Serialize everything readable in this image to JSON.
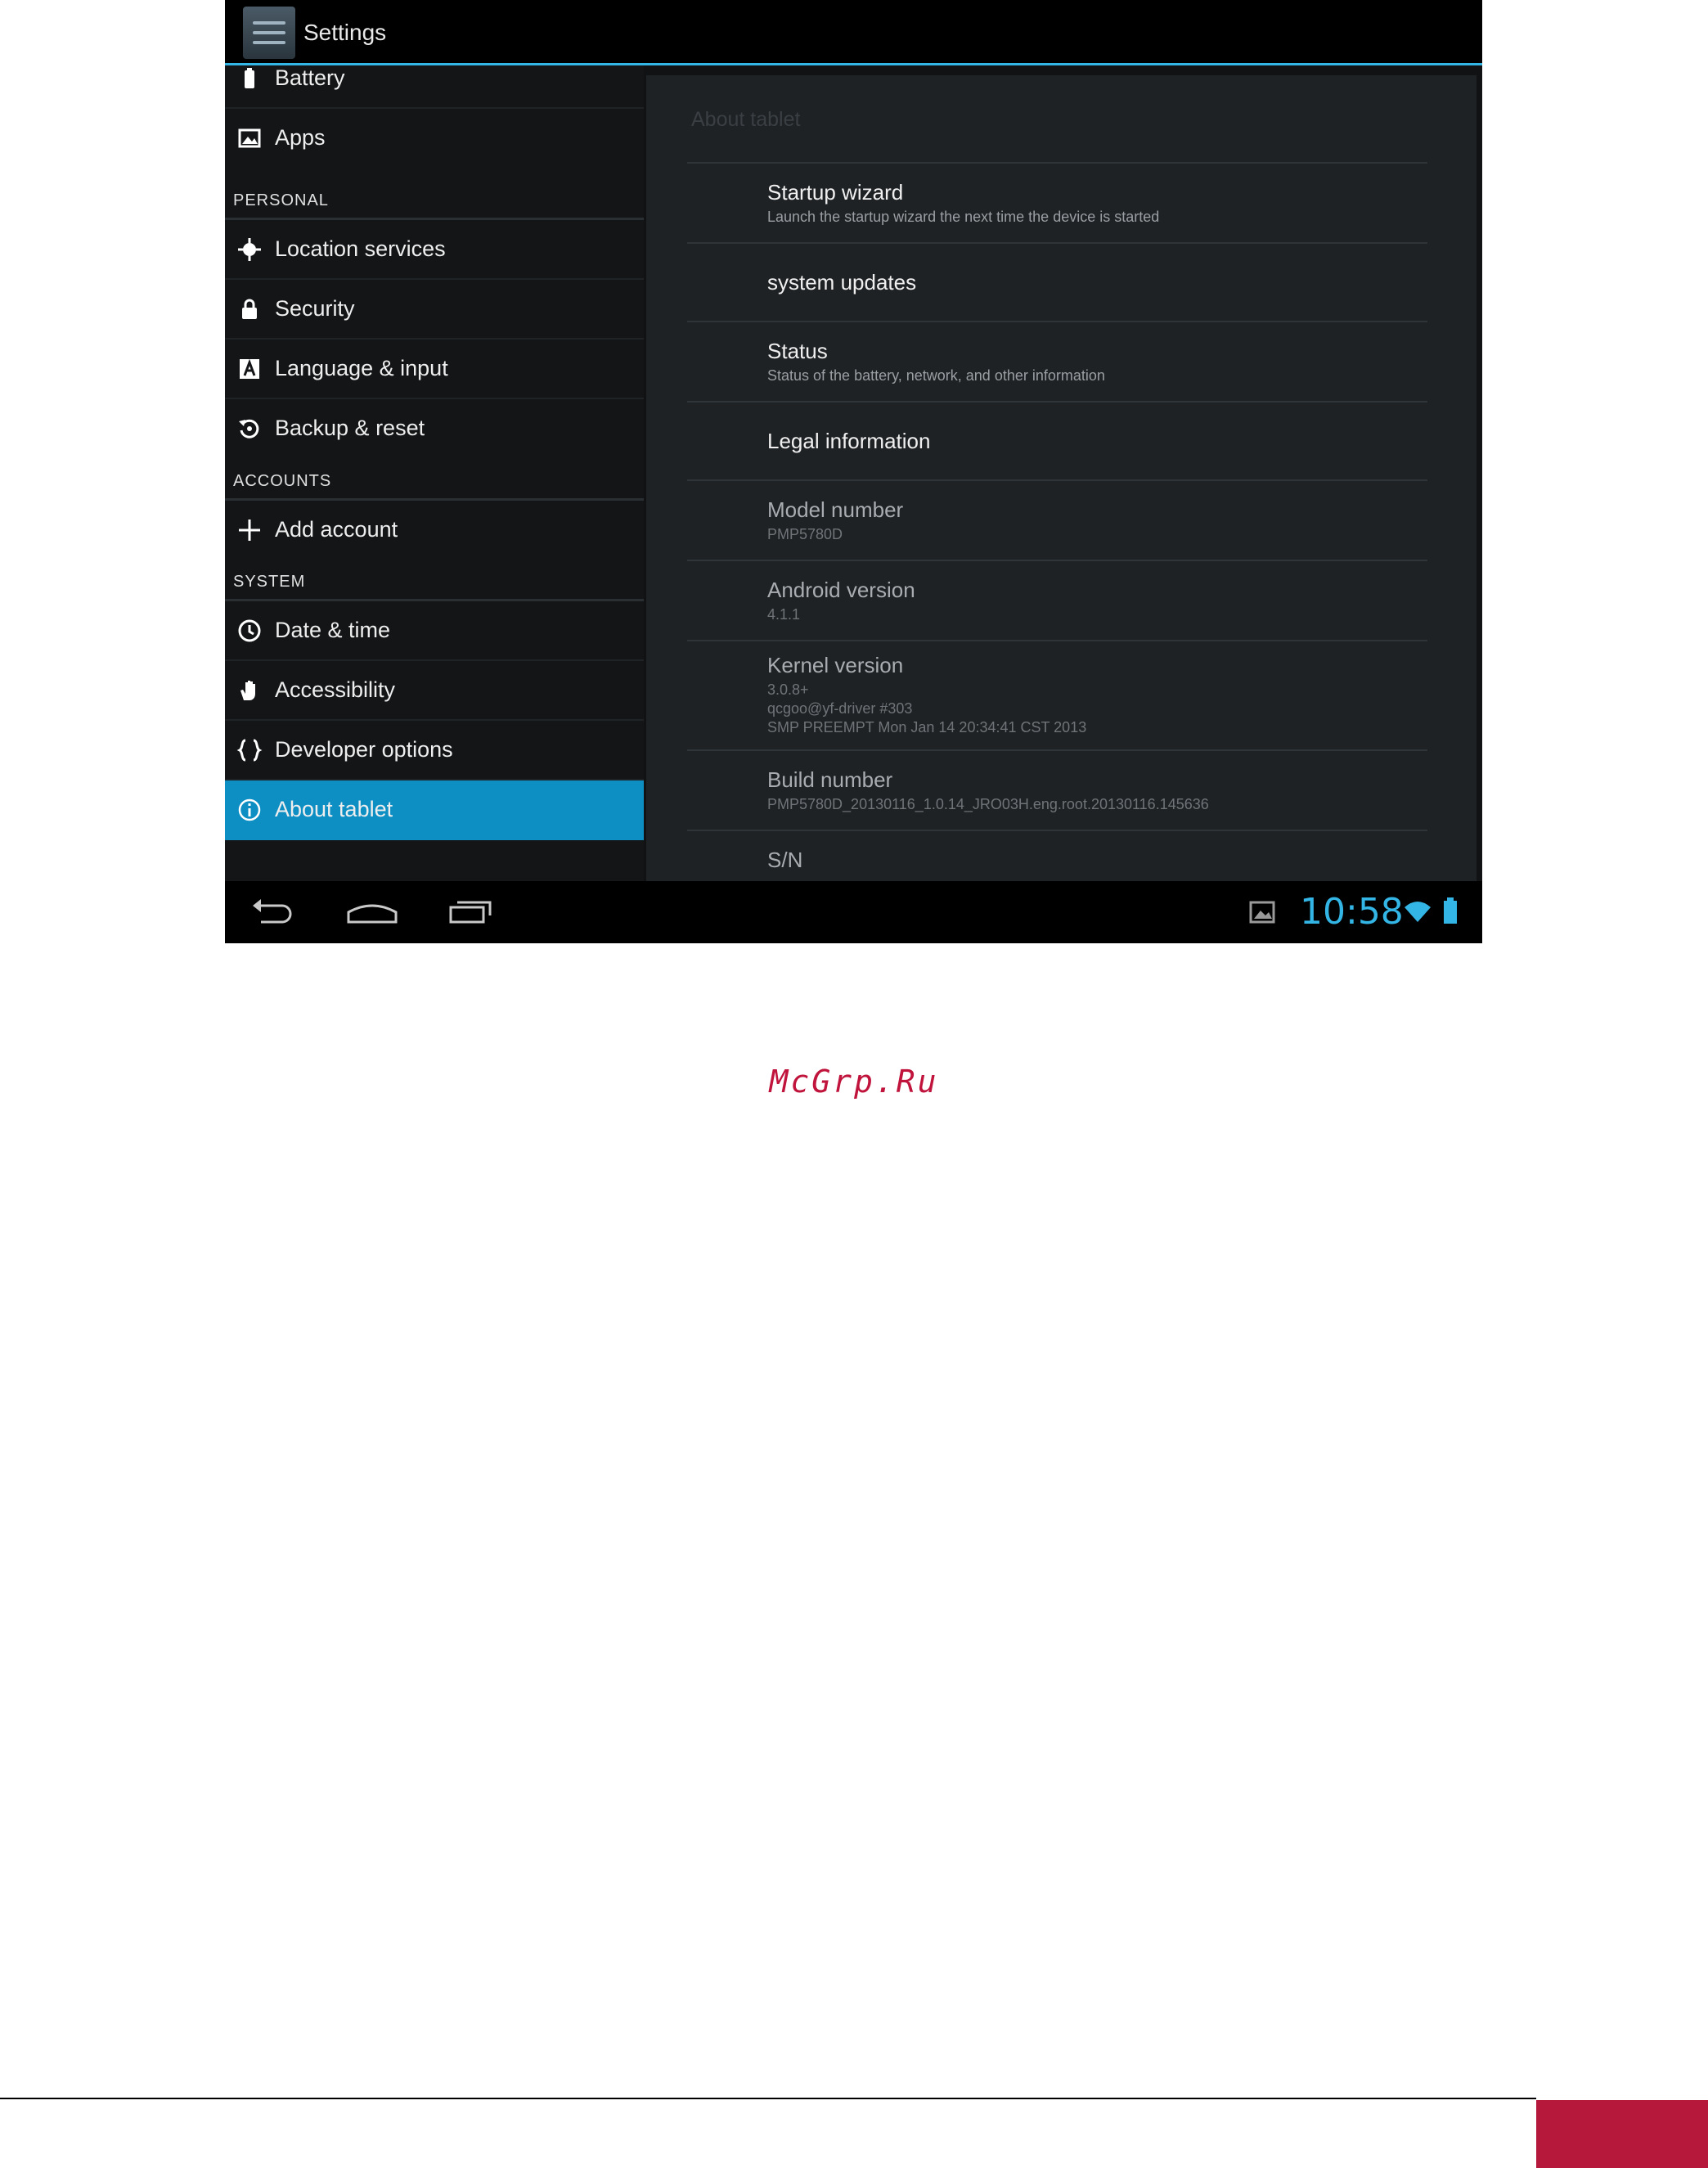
{
  "action_bar": {
    "title": "Settings",
    "icon": "settings-app-icon",
    "accent_color": "#33b5e5"
  },
  "left_pane": {
    "items_top": [
      {
        "label": "Battery",
        "icon": "battery-icon"
      },
      {
        "label": "Apps",
        "icon": "apps-icon"
      }
    ],
    "section_personal": "PERSONAL",
    "items_personal": [
      {
        "label": "Location services",
        "icon": "location-icon"
      },
      {
        "label": "Security",
        "icon": "lock-icon"
      },
      {
        "label": "Language & input",
        "icon": "language-icon"
      },
      {
        "label": "Backup & reset",
        "icon": "backup-icon"
      }
    ],
    "section_accounts": "ACCOUNTS",
    "items_accounts": [
      {
        "label": "Add account",
        "icon": "plus-icon"
      }
    ],
    "section_system": "SYSTEM",
    "items_system": [
      {
        "label": "Date & time",
        "icon": "clock-icon"
      },
      {
        "label": "Accessibility",
        "icon": "hand-icon"
      },
      {
        "label": "Developer options",
        "icon": "braces-icon"
      },
      {
        "label": "About tablet",
        "icon": "info-icon",
        "selected": true
      }
    ],
    "selected_color": "#0e8fc4"
  },
  "right_pane": {
    "title": "About tablet",
    "rows": [
      {
        "title": "Startup wizard",
        "subtitle": "Launch the startup wizard the next time the device is started"
      },
      {
        "title": "system updates"
      },
      {
        "title": "Status",
        "subtitle": "Status of the battery, network, and other information"
      },
      {
        "title": "Legal information"
      },
      {
        "title": "Model number",
        "subtitle": "PMP5780D"
      },
      {
        "title": "Android version",
        "subtitle": "4.1.1"
      },
      {
        "title": "Kernel version",
        "subtitle": "3.0.8+\nqcgoo@yf-driver #303\nSMP PREEMPT Mon Jan 14 20:34:41 CST 2013"
      },
      {
        "title": "Build number",
        "subtitle": "PMP5780D_20130116_1.0.14_JRO03H.eng.root.20130116.145636"
      },
      {
        "title": "S/N"
      }
    ]
  },
  "nav_bar": {
    "clock": "10:58",
    "clock_color": "#33b5e5"
  },
  "page": {
    "watermark": "McGrp.Ru",
    "brand_color": "#b5183a"
  }
}
